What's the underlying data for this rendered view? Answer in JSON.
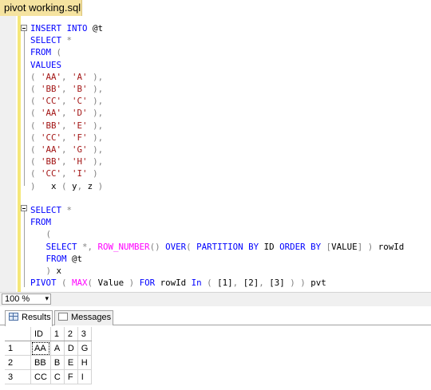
{
  "tab": {
    "title": "pivot working.sql...f"
  },
  "editor": {
    "lines": [
      [
        [
          "kw",
          "INSERT INTO "
        ],
        [
          "plain",
          "@t"
        ]
      ],
      [
        [
          "kw",
          "SELECT "
        ],
        [
          "op",
          "*"
        ]
      ],
      [
        [
          "kw",
          "FROM "
        ],
        [
          "op",
          "("
        ]
      ],
      [
        [
          "kw",
          "VALUES"
        ]
      ],
      [
        [
          "op",
          "( "
        ],
        [
          "str",
          "'AA'"
        ],
        [
          "op",
          ", "
        ],
        [
          "str",
          "'A'"
        ],
        [
          "op",
          " ),"
        ]
      ],
      [
        [
          "op",
          "( "
        ],
        [
          "str",
          "'BB'"
        ],
        [
          "op",
          ", "
        ],
        [
          "str",
          "'B'"
        ],
        [
          "op",
          " ),"
        ]
      ],
      [
        [
          "op",
          "( "
        ],
        [
          "str",
          "'CC'"
        ],
        [
          "op",
          ", "
        ],
        [
          "str",
          "'C'"
        ],
        [
          "op",
          " ),"
        ]
      ],
      [
        [
          "op",
          "( "
        ],
        [
          "str",
          "'AA'"
        ],
        [
          "op",
          ", "
        ],
        [
          "str",
          "'D'"
        ],
        [
          "op",
          " ),"
        ]
      ],
      [
        [
          "op",
          "( "
        ],
        [
          "str",
          "'BB'"
        ],
        [
          "op",
          ", "
        ],
        [
          "str",
          "'E'"
        ],
        [
          "op",
          " ),"
        ]
      ],
      [
        [
          "op",
          "( "
        ],
        [
          "str",
          "'CC'"
        ],
        [
          "op",
          ", "
        ],
        [
          "str",
          "'F'"
        ],
        [
          "op",
          " ),"
        ]
      ],
      [
        [
          "op",
          "( "
        ],
        [
          "str",
          "'AA'"
        ],
        [
          "op",
          ", "
        ],
        [
          "str",
          "'G'"
        ],
        [
          "op",
          " ),"
        ]
      ],
      [
        [
          "op",
          "( "
        ],
        [
          "str",
          "'BB'"
        ],
        [
          "op",
          ", "
        ],
        [
          "str",
          "'H'"
        ],
        [
          "op",
          " ),"
        ]
      ],
      [
        [
          "op",
          "( "
        ],
        [
          "str",
          "'CC'"
        ],
        [
          "op",
          ", "
        ],
        [
          "str",
          "'I'"
        ],
        [
          "op",
          " )"
        ]
      ],
      [
        [
          "op",
          ")   "
        ],
        [
          "plain",
          "x "
        ],
        [
          "op",
          "( "
        ],
        [
          "plain",
          "y"
        ],
        [
          "op",
          ", "
        ],
        [
          "plain",
          "z "
        ],
        [
          "op",
          ")"
        ]
      ],
      [
        [
          "plain",
          ""
        ]
      ],
      [
        [
          "kw",
          "SELECT "
        ],
        [
          "op",
          "*"
        ]
      ],
      [
        [
          "kw",
          "FROM"
        ]
      ],
      [
        [
          "plain",
          "   "
        ],
        [
          "op",
          "("
        ]
      ],
      [
        [
          "plain",
          "   "
        ],
        [
          "kw",
          "SELECT "
        ],
        [
          "op",
          "*, "
        ],
        [
          "fn",
          "ROW_NUMBER"
        ],
        [
          "op",
          "() "
        ],
        [
          "kw",
          "OVER"
        ],
        [
          "op",
          "( "
        ],
        [
          "kw",
          "PARTITION BY "
        ],
        [
          "plain",
          "ID "
        ],
        [
          "kw",
          "ORDER BY "
        ],
        [
          "op",
          "["
        ],
        [
          "plain",
          "VALUE"
        ],
        [
          "op",
          "] ) "
        ],
        [
          "plain",
          "rowId"
        ]
      ],
      [
        [
          "plain",
          "   "
        ],
        [
          "kw",
          "FROM "
        ],
        [
          "plain",
          "@t"
        ]
      ],
      [
        [
          "plain",
          "   "
        ],
        [
          "op",
          ") "
        ],
        [
          "plain",
          "x"
        ]
      ],
      [
        [
          "kw",
          "PIVOT "
        ],
        [
          "op",
          "( "
        ],
        [
          "fn",
          "MAX"
        ],
        [
          "op",
          "( "
        ],
        [
          "plain",
          "Value "
        ],
        [
          "op",
          ") "
        ],
        [
          "kw",
          "FOR "
        ],
        [
          "plain",
          "rowId "
        ],
        [
          "kw",
          "In "
        ],
        [
          "op",
          "( "
        ],
        [
          "plain",
          "[1]"
        ],
        [
          "op",
          ", "
        ],
        [
          "plain",
          "[2]"
        ],
        [
          "op",
          ", "
        ],
        [
          "plain",
          "[3] "
        ],
        [
          "op",
          ") ) "
        ],
        [
          "plain",
          "pvt"
        ]
      ]
    ]
  },
  "zoom": {
    "value": "100 %",
    "arrow": "▾"
  },
  "results": {
    "tabs": [
      {
        "label": "Results",
        "icon": "grid-icon",
        "active": true
      },
      {
        "label": "Messages",
        "icon": "messages-icon",
        "active": false
      }
    ],
    "columns": [
      "",
      "ID",
      "1",
      "2",
      "3"
    ],
    "rows": [
      [
        "1",
        "AA",
        "A",
        "D",
        "G"
      ],
      [
        "2",
        "BB",
        "B",
        "E",
        "H"
      ],
      [
        "3",
        "CC",
        "C",
        "F",
        "I"
      ]
    ]
  }
}
